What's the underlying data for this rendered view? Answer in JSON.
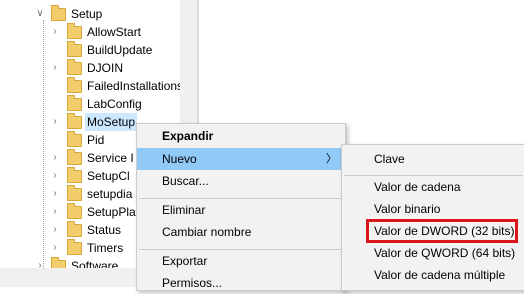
{
  "tree": {
    "parent": {
      "label": "Setup",
      "expanded": true
    },
    "items": [
      {
        "label": "AllowStart",
        "has_children": true
      },
      {
        "label": "BuildUpdate",
        "has_children": false
      },
      {
        "label": "DJOIN",
        "has_children": true
      },
      {
        "label": "FailedInstallations",
        "has_children": false
      },
      {
        "label": "LabConfig",
        "has_children": false
      },
      {
        "label": "MoSetup",
        "has_children": true,
        "selected": true
      },
      {
        "label": "Pid",
        "has_children": false
      },
      {
        "label": "Service I",
        "has_children": true
      },
      {
        "label": "SetupCl",
        "has_children": true
      },
      {
        "label": "setupdia",
        "has_children": true
      },
      {
        "label": "SetupPla",
        "has_children": true
      },
      {
        "label": "Status",
        "has_children": true
      },
      {
        "label": "Timers",
        "has_children": true
      }
    ],
    "next_sibling": {
      "label": "Software"
    }
  },
  "context_menu": {
    "items": [
      {
        "label": "Expandir",
        "bold": true
      },
      {
        "label": "Nuevo",
        "has_submenu": true,
        "highlighted": true
      },
      {
        "label": "Buscar..."
      },
      {
        "label": "Eliminar"
      },
      {
        "label": "Cambiar nombre"
      },
      {
        "label": "Exportar"
      },
      {
        "label": "Permisos..."
      }
    ],
    "submenu_arrow_icon": "chevron-right-icon"
  },
  "submenu": {
    "items": [
      {
        "label": "Clave"
      },
      {
        "label": "Valor de cadena"
      },
      {
        "label": "Valor binario"
      },
      {
        "label": "Valor de DWORD (32 bits)",
        "annotated": true
      },
      {
        "label": "Valor de QWORD (64 bits)"
      },
      {
        "label": "Valor de cadena múltiple"
      }
    ]
  },
  "colors": {
    "menu_highlight": "#91c9f7",
    "selection": "#cce8ff",
    "annotation_box": "#d9161c",
    "folder": "#f3cd6b"
  }
}
